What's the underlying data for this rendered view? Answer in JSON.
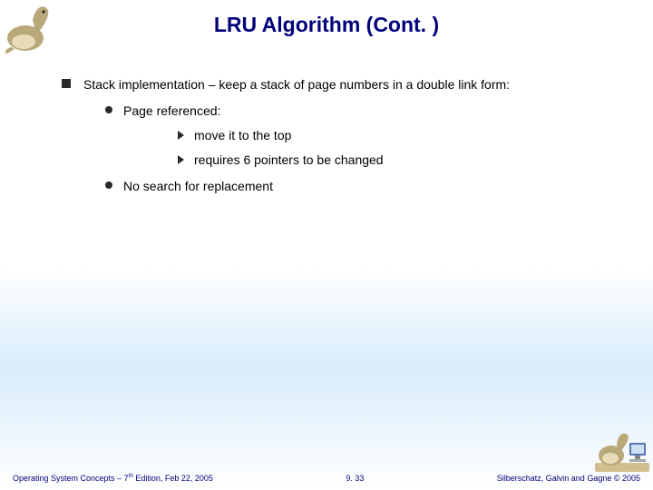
{
  "title": "LRU Algorithm (Cont. )",
  "bullets": {
    "main": "Stack implementation – keep a stack of page numbers in a double link form:",
    "sub1": "Page referenced:",
    "arrow1": "move it to the top",
    "arrow2": "requires 6 pointers to be changed",
    "sub2": "No search for replacement"
  },
  "footer": {
    "left_prefix": "Operating System Concepts – 7",
    "left_sup": "th",
    "left_suffix": " Edition, Feb 22, 2005",
    "center": "9. 33",
    "right": "Silberschatz, Galvin and Gagne © 2005"
  },
  "icons": {
    "dino_top": "dinosaur-mascot",
    "dino_bottom": "dinosaur-computer-mascot"
  }
}
